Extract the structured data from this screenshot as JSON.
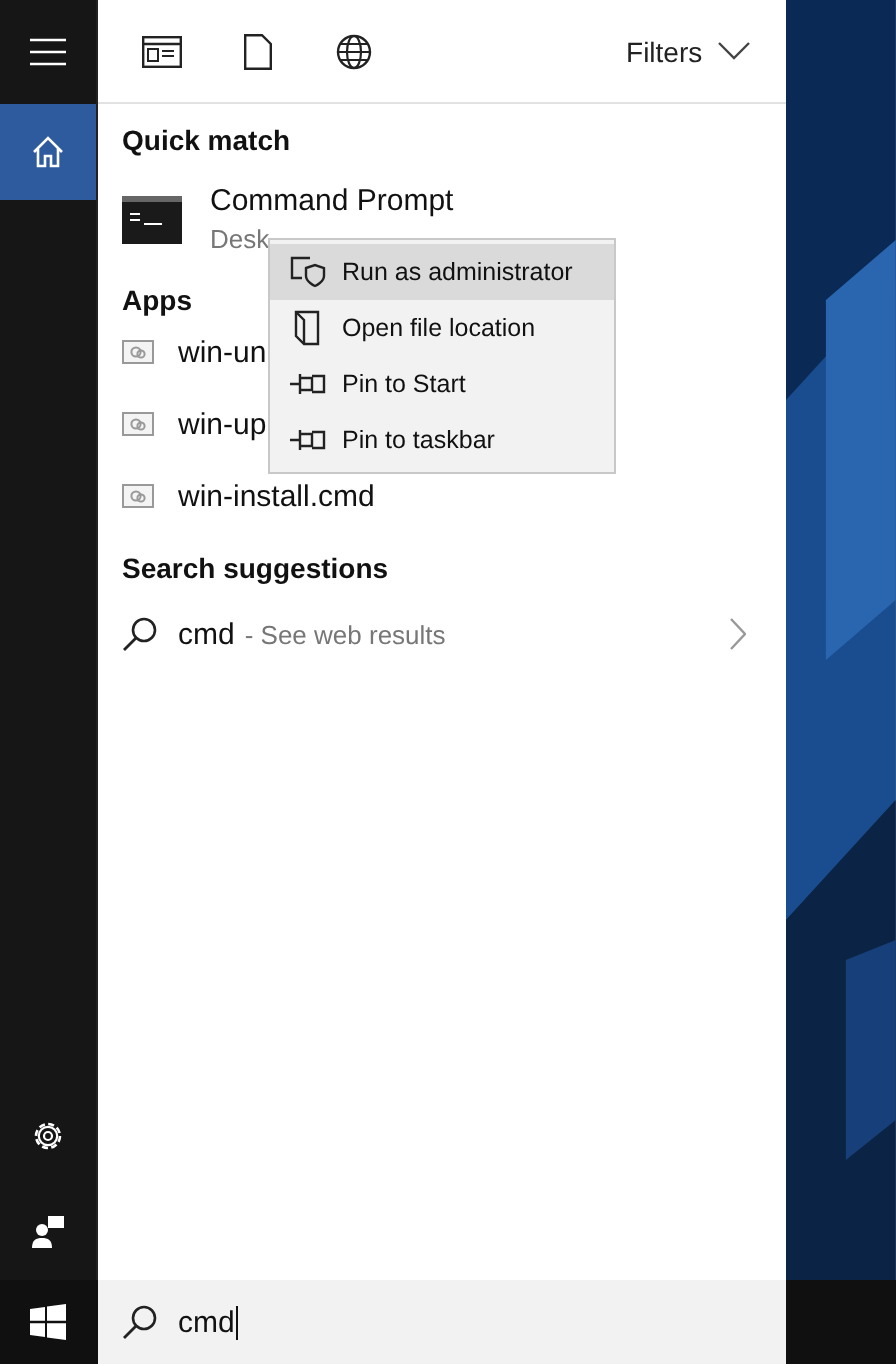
{
  "sidebar": {
    "items": [
      {
        "kind": "menu",
        "selected": false
      },
      {
        "kind": "home",
        "selected": true
      },
      {
        "kind": "settings",
        "selected": false
      },
      {
        "kind": "feedback",
        "selected": false
      }
    ]
  },
  "toolbar": {
    "icons": [
      {
        "kind": "apps"
      },
      {
        "kind": "documents"
      },
      {
        "kind": "web"
      }
    ],
    "filters": "Filters"
  },
  "quick_match": {
    "heading": "Quick match",
    "title": "Command Prompt",
    "subtitle": "Desk"
  },
  "apps": {
    "heading": "Apps",
    "items": [
      "win-un",
      "win-up",
      "win-install.cmd"
    ]
  },
  "suggestions": {
    "heading": "Search suggestions",
    "items": [
      {
        "query": "cmd",
        "hint": "- See web results"
      }
    ]
  },
  "context_menu": {
    "items": [
      {
        "kind": "shield",
        "label": "Run as administrator",
        "selected": true
      },
      {
        "kind": "folder",
        "label": "Open file location",
        "selected": false
      },
      {
        "kind": "pin",
        "label": "Pin to Start",
        "selected": false
      },
      {
        "kind": "pin",
        "label": "Pin to taskbar",
        "selected": false
      }
    ]
  },
  "search": {
    "value": "cmd"
  }
}
